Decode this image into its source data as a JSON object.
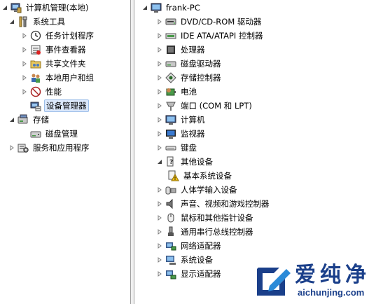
{
  "left_tree": {
    "root": "计算机管理(本地)",
    "system_tools": "系统工具",
    "items": [
      {
        "label": "任务计划程序",
        "icon": "clock-icon"
      },
      {
        "label": "事件查看器",
        "icon": "event-viewer-icon"
      },
      {
        "label": "共享文件夹",
        "icon": "shared-folder-icon"
      },
      {
        "label": "本地用户和组",
        "icon": "users-icon"
      },
      {
        "label": "性能",
        "icon": "performance-icon"
      },
      {
        "label": "设备管理器",
        "icon": "device-manager-icon"
      }
    ],
    "storage": "存储",
    "disk_management": "磁盘管理",
    "services": "服务和应用程序"
  },
  "right_tree": {
    "root": "frank-PC",
    "categories": [
      {
        "label": "DVD/CD-ROM 驱动器",
        "icon": "dvd-drive-icon"
      },
      {
        "label": "IDE ATA/ATAPI 控制器",
        "icon": "ide-controller-icon"
      },
      {
        "label": "处理器",
        "icon": "processor-icon"
      },
      {
        "label": "磁盘驱动器",
        "icon": "disk-drive-icon"
      },
      {
        "label": "存储控制器",
        "icon": "storage-controller-icon"
      },
      {
        "label": "电池",
        "icon": "battery-icon"
      },
      {
        "label": "端口 (COM 和 LPT)",
        "icon": "port-icon"
      },
      {
        "label": "计算机",
        "icon": "computer-icon"
      },
      {
        "label": "监视器",
        "icon": "monitor-icon"
      },
      {
        "label": "键盘",
        "icon": "keyboard-icon"
      },
      {
        "label": "其他设备",
        "icon": "other-devices-icon"
      },
      {
        "label": "基本系统设备",
        "icon": "warning-device-icon"
      },
      {
        "label": "人体学输入设备",
        "icon": "hid-icon"
      },
      {
        "label": "声音、视频和游戏控制器",
        "icon": "sound-icon"
      },
      {
        "label": "鼠标和其他指针设备",
        "icon": "mouse-icon"
      },
      {
        "label": "通用串行总线控制器",
        "icon": "usb-icon"
      },
      {
        "label": "网络适配器",
        "icon": "network-adapter-icon"
      },
      {
        "label": "系统设备",
        "icon": "system-device-icon"
      },
      {
        "label": "显示适配器",
        "icon": "display-adapter-icon"
      }
    ]
  },
  "watermark": {
    "brand": "爱纯净",
    "url": "aichunjing.com"
  }
}
